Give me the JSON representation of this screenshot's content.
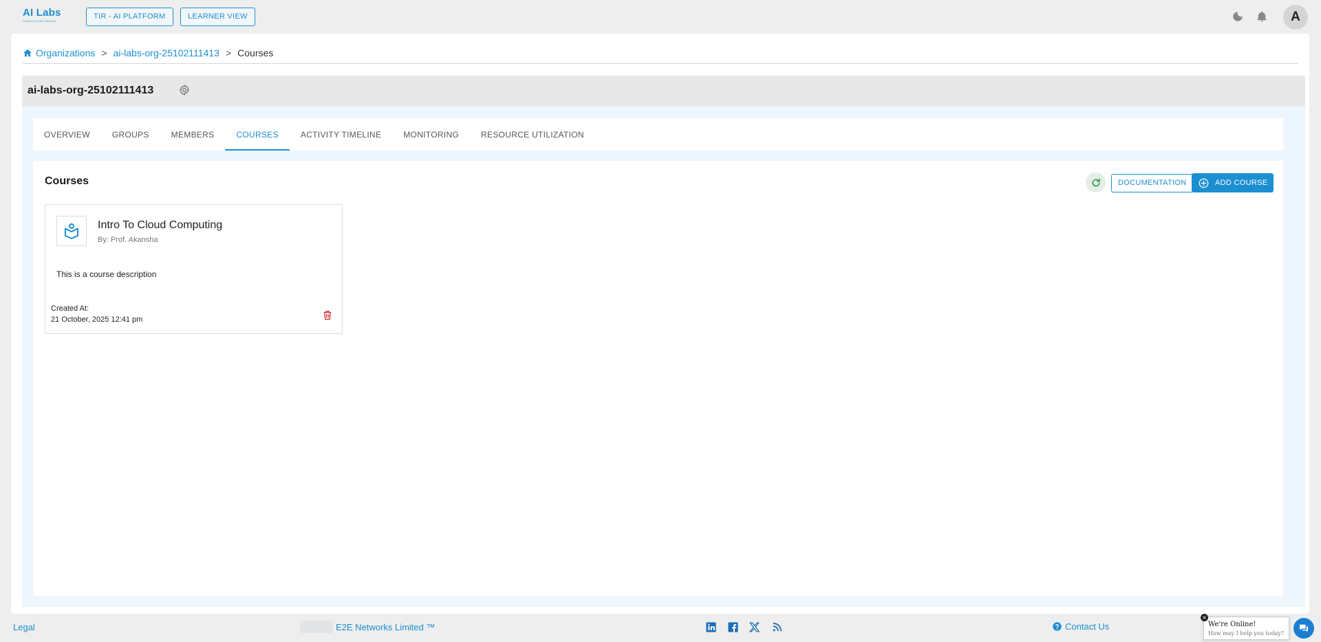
{
  "header": {
    "logo_text": "AI Labs",
    "logo_subtext": "Powered by E2E Networks",
    "tir_button": "TIR - AI PLATFORM",
    "learner_button": "LEARNER VIEW",
    "avatar_initial": "A",
    "icons": [
      "moon-icon",
      "bell-icon"
    ]
  },
  "breadcrumb": {
    "items": [
      "Organizations",
      "ai-labs-org-25102111413",
      "Courses"
    ],
    "separator": ">"
  },
  "org": {
    "title": "ai-labs-org-25102111413"
  },
  "tabs": [
    {
      "label": "OVERVIEW",
      "active": false
    },
    {
      "label": "GROUPS",
      "active": false
    },
    {
      "label": "MEMBERS",
      "active": false
    },
    {
      "label": "COURSES",
      "active": true
    },
    {
      "label": "ACTIVITY TIMELINE",
      "active": false
    },
    {
      "label": "MONITORING",
      "active": false
    },
    {
      "label": "RESOURCE UTILIZATION",
      "active": false
    }
  ],
  "courses": {
    "title": "Courses",
    "documentation_button": "DOCUMENTATION",
    "add_button": "ADD COURSE",
    "items": [
      {
        "name": "Intro To Cloud Computing",
        "author": "By: Prof. Akansha",
        "description": "This is a course description",
        "created_label": "Created At:",
        "created_value": "21 October, 2025 12:41 pm"
      }
    ]
  },
  "footer": {
    "legal": "Legal",
    "company": "E2E Networks Limited ™",
    "contact": "Contact Us",
    "social": [
      "linkedin-icon",
      "facebook-icon",
      "x-icon",
      "rss-icon"
    ]
  },
  "chat": {
    "title": "We're Online!",
    "subtitle": "How may I help you today?",
    "close": "×"
  },
  "colors": {
    "accent": "#1b8fd1",
    "delete": "#d32f2f",
    "refresh": "#2e9d4f"
  }
}
